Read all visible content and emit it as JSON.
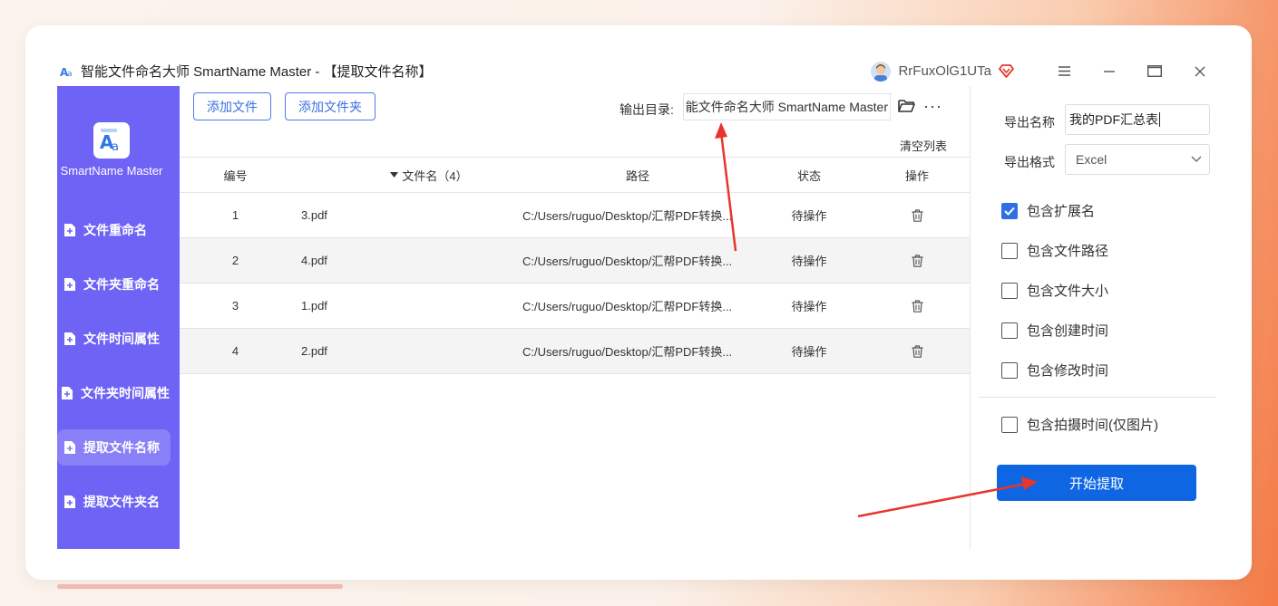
{
  "window": {
    "title": "智能文件命名大师 SmartName Master - 【提取文件名称】",
    "username": "RrFuxOlG1UTa"
  },
  "sidebar": {
    "brand": "SmartName Master",
    "items": [
      {
        "label": "文件重命名"
      },
      {
        "label": "文件夹重命名"
      },
      {
        "label": "文件时间属性"
      },
      {
        "label": "文件夹时间属性"
      },
      {
        "label": "提取文件名称"
      },
      {
        "label": "提取文件夹名"
      }
    ]
  },
  "toolbar": {
    "add_file": "添加文件",
    "add_folder": "添加文件夹",
    "output_label": "输出目录:",
    "output_value": "能文件命名大师 SmartName Master",
    "more": "···",
    "clear_list": "清空列表"
  },
  "table": {
    "headers": {
      "num": "编号",
      "name": "文件名（4）",
      "path": "路径",
      "status": "状态",
      "op": "操作"
    },
    "rows": [
      {
        "num": "1",
        "name": "3.pdf",
        "path": "C:/Users/ruguo/Desktop/汇帮PDF转换...",
        "status": "待操作"
      },
      {
        "num": "2",
        "name": "4.pdf",
        "path": "C:/Users/ruguo/Desktop/汇帮PDF转换...",
        "status": "待操作"
      },
      {
        "num": "3",
        "name": "1.pdf",
        "path": "C:/Users/ruguo/Desktop/汇帮PDF转换...",
        "status": "待操作"
      },
      {
        "num": "4",
        "name": "2.pdf",
        "path": "C:/Users/ruguo/Desktop/汇帮PDF转换...",
        "status": "待操作"
      }
    ]
  },
  "panel": {
    "export_name_label": "导出名称",
    "export_name_value": "我的PDF汇总表",
    "export_format_label": "导出格式",
    "export_format_value": "Excel",
    "options": [
      {
        "label": "包含扩展名",
        "checked": true
      },
      {
        "label": "包含文件路径",
        "checked": false
      },
      {
        "label": "包含文件大小",
        "checked": false
      },
      {
        "label": "包含创建时间",
        "checked": false
      },
      {
        "label": "包含修改时间",
        "checked": false
      }
    ],
    "photo_option": {
      "label": "包含拍摄时间(仅图片)",
      "checked": false
    },
    "start_button": "开始提取"
  },
  "colors": {
    "sidebar": "#6f63f5",
    "accent": "#0f66e3",
    "annotation_arrow": "#e8352b"
  }
}
